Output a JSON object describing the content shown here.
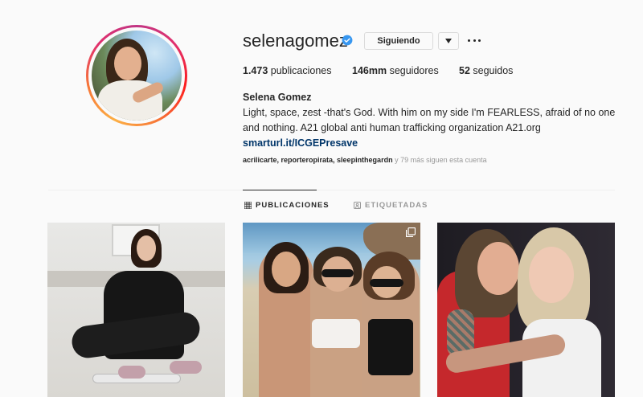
{
  "profile": {
    "username": "selenagomez",
    "following_button": "Siguiendo",
    "stats": {
      "posts_count": "1.473",
      "posts_label": " publicaciones",
      "followers_count": "146mm",
      "followers_label": " seguidores",
      "following_count": "52",
      "following_label": " seguidos"
    },
    "bio": {
      "name": "Selena Gomez",
      "text": "Light, space, zest -that's God. With him on my side I'm FEARLESS, afraid of no one and nothing. A21 global anti human trafficking organization A21.org",
      "link": "smarturl.it/ICGEPresave"
    },
    "followed_by": {
      "users": "acrilicarte, reporteropirata, sleepinthegardn",
      "suffix": " y 79 más siguen esta cuenta"
    }
  },
  "tabs": [
    {
      "label": "PUBLICACIONES",
      "active": true,
      "icon": "grid-icon"
    },
    {
      "label": "ETIQUETADAS",
      "active": false,
      "icon": "tagged-icon"
    }
  ],
  "colors": {
    "verified": "#3897f0",
    "link": "#003569",
    "text": "#262626",
    "muted": "#999999"
  }
}
